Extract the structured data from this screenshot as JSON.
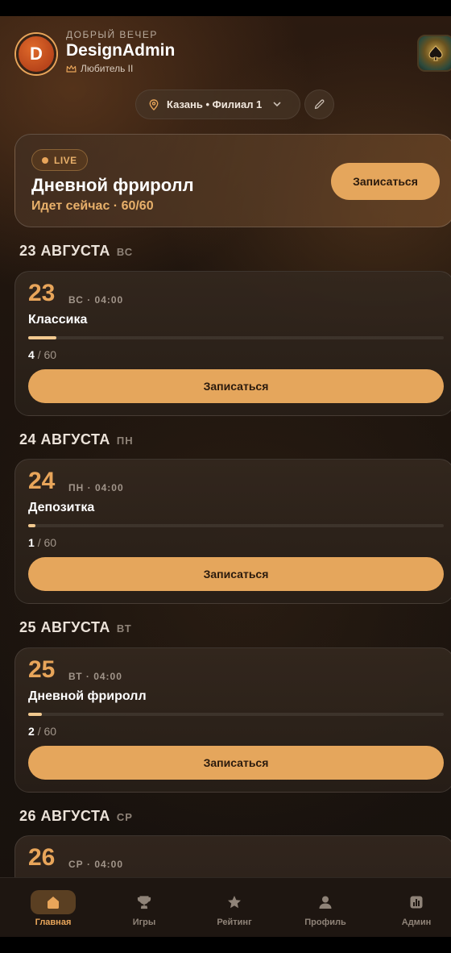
{
  "header": {
    "avatar_letter": "D",
    "greeting": "ДОБРЫЙ ВЕЧЕР",
    "username": "DesignAdmin",
    "level": "Любитель II",
    "game_icon": "spade-icon"
  },
  "location": {
    "label": "Казань • Филиал 1",
    "icon": "pin-icon"
  },
  "live": {
    "badge": "LIVE",
    "title": "Дневной фриролл",
    "subtitle": "Идет сейчас · 60/60",
    "button": "Записаться"
  },
  "sections": [
    {
      "date": "23 АВГУСТА",
      "dow": "ВС",
      "card": {
        "day": "23",
        "meta": "ВС · 04:00",
        "name": "Классика",
        "registered": "4",
        "capacity": "/ 60",
        "progress": 0.067,
        "button": "Записаться"
      }
    },
    {
      "date": "24 АВГУСТА",
      "dow": "ПН",
      "card": {
        "day": "24",
        "meta": "ПН · 04:00",
        "name": "Депозитка",
        "registered": "1",
        "capacity": "/ 60",
        "progress": 0.017,
        "button": "Записаться"
      }
    },
    {
      "date": "25 АВГУСТА",
      "dow": "ВТ",
      "card": {
        "day": "25",
        "meta": "ВТ · 04:00",
        "name": "Дневной фриролл",
        "registered": "2",
        "capacity": "/ 60",
        "progress": 0.033,
        "button": "Записаться"
      }
    },
    {
      "date": "26 АВГУСТА",
      "dow": "СР",
      "card": {
        "day": "26",
        "meta": "СР · 04:00"
      }
    }
  ],
  "nav": [
    {
      "label": "Главная",
      "icon": "home-icon",
      "active": true
    },
    {
      "label": "Игры",
      "icon": "trophy-icon"
    },
    {
      "label": "Рейтинг",
      "icon": "star-icon"
    },
    {
      "label": "Профиль",
      "icon": "user-icon"
    },
    {
      "label": "Админ",
      "icon": "chart-icon"
    }
  ],
  "colors": {
    "accent": "#e5a65c",
    "accent_text": "#e8a55a",
    "background": "#1a130e"
  }
}
